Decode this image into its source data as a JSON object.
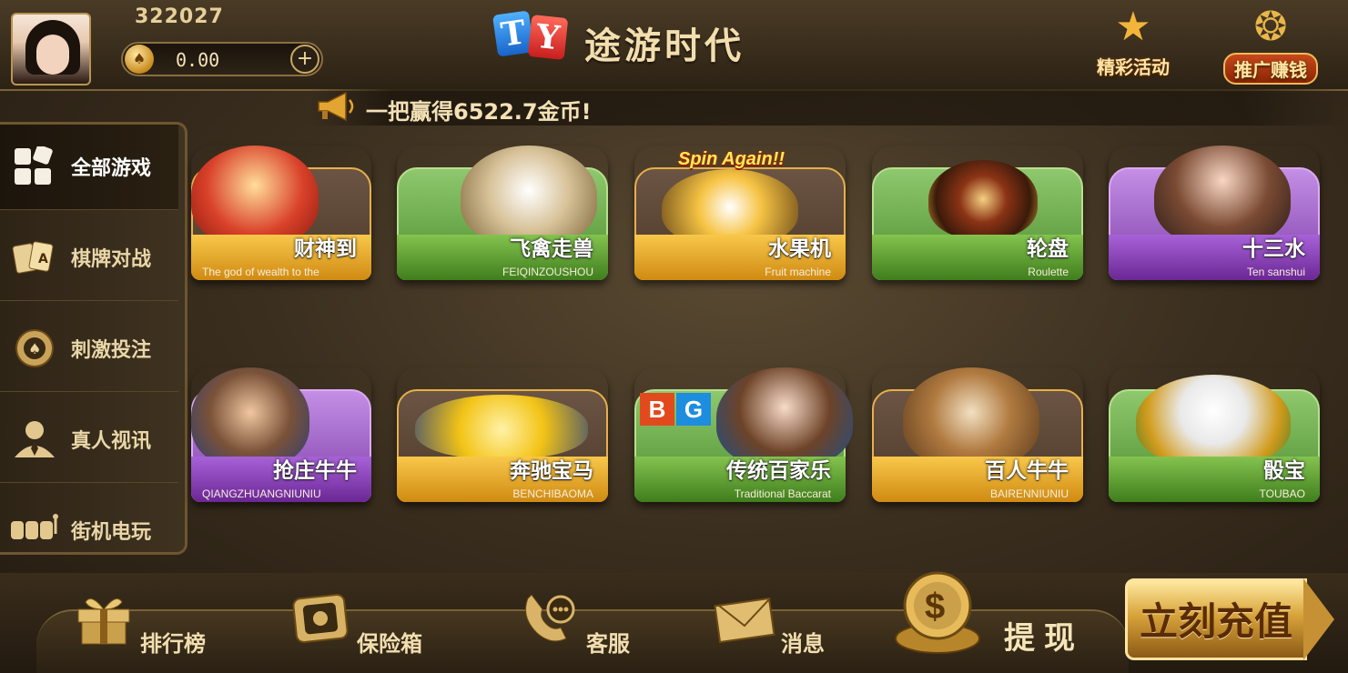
{
  "user": {
    "id": "322027",
    "balance": "0.00",
    "add_symbol": "+"
  },
  "app": {
    "title": "途游时代",
    "logo_left": "T",
    "logo_right": "Y"
  },
  "top_buttons": {
    "events_label": "精彩活动",
    "promo_label": "推广赚钱"
  },
  "marquee": {
    "text": "一把赢得6522.7金币!"
  },
  "sidebar": {
    "items": [
      {
        "label": "全部游戏",
        "icon": "grid-icon",
        "active": true
      },
      {
        "label": "棋牌对战",
        "icon": "cards-icon",
        "active": false
      },
      {
        "label": "刺激投注",
        "icon": "chip-icon",
        "active": false
      },
      {
        "label": "真人视讯",
        "icon": "dealer-icon",
        "active": false
      },
      {
        "label": "街机电玩",
        "icon": "slot-icon",
        "active": false
      }
    ]
  },
  "games": [
    {
      "cn": "财神到",
      "en": "The god of wealth to the",
      "theme": "orange"
    },
    {
      "cn": "飞禽走兽",
      "en": "FEIQINZOUSHOU",
      "theme": "green"
    },
    {
      "cn": "水果机",
      "en": "Fruit machine",
      "theme": "orange",
      "art_text": "Spin Again!!"
    },
    {
      "cn": "轮盘",
      "en": "Roulette",
      "theme": "green"
    },
    {
      "cn": "十三水",
      "en": "Ten sanshui",
      "theme": "purple"
    },
    {
      "cn": "抢庄牛牛",
      "en": "QIANGZHUANGNIUNIU",
      "theme": "purple"
    },
    {
      "cn": "奔驰宝马",
      "en": "BENCHIBAOMA",
      "theme": "orange"
    },
    {
      "cn": "传统百家乐",
      "en": "Traditional Baccarat",
      "theme": "green",
      "badge": [
        "B",
        "G"
      ]
    },
    {
      "cn": "百人牛牛",
      "en": "BAIRENNIUNIU",
      "theme": "orange"
    },
    {
      "cn": "骰宝",
      "en": "TOUBAO",
      "theme": "green"
    }
  ],
  "bottom": {
    "rank_label": "排行榜",
    "safe_label": "保险箱",
    "service_label": "客服",
    "message_label": "消息",
    "withdraw_label": "提现",
    "recharge_label": "立刻充值"
  },
  "colors": {
    "gold": "#e7b04a",
    "green": "#4d8e2f",
    "purple": "#7d3ea8",
    "background": "#3b2f1f"
  }
}
